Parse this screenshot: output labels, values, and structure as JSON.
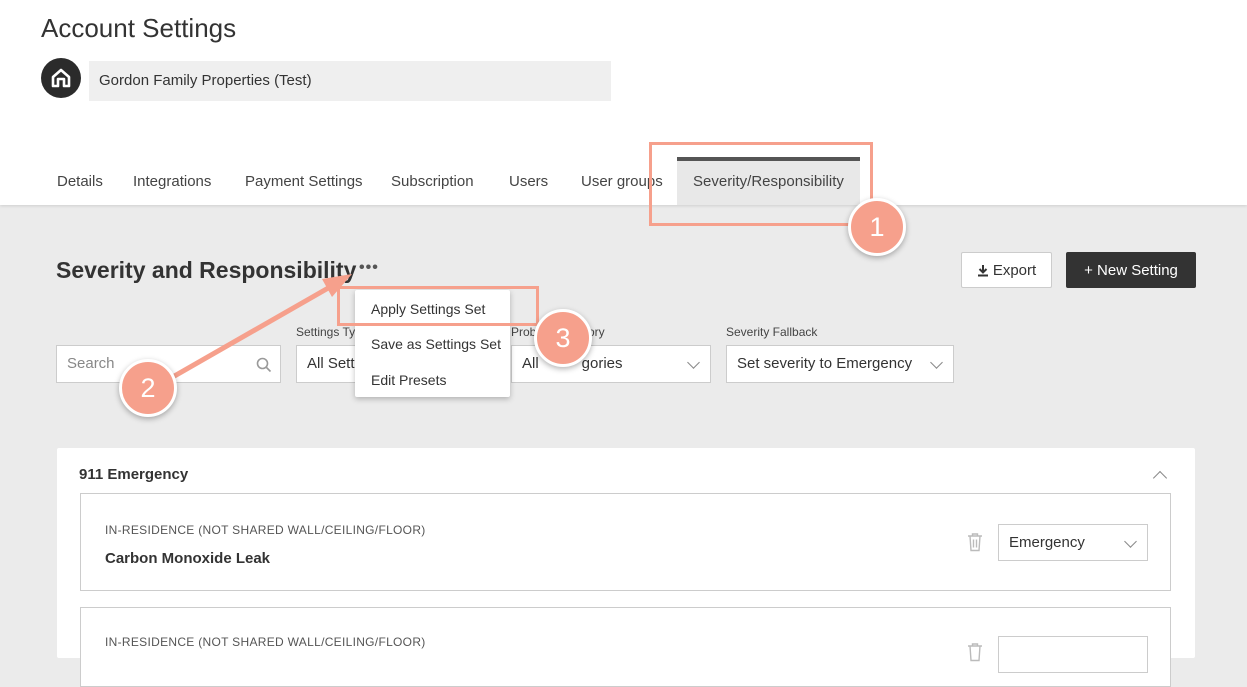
{
  "header": {
    "title": "Account Settings",
    "account_name": "Gordon Family Properties (Test)"
  },
  "tabs": [
    {
      "label": "Details"
    },
    {
      "label": "Integrations"
    },
    {
      "label": "Payment Settings"
    },
    {
      "label": "Subscription"
    },
    {
      "label": "Users"
    },
    {
      "label": "User groups"
    },
    {
      "label": "Severity/Responsibility",
      "active": true
    }
  ],
  "section": {
    "title": "Severity and Responsibility",
    "more": "•••",
    "export_label": "Export",
    "new_setting_label": "+ New Setting"
  },
  "filters": {
    "search_placeholder": "Search",
    "settings_type_label": "Settings Ty",
    "settings_type_value": "All Sett",
    "problem_category_label_a": "Prob",
    "problem_category_label_b": "ory",
    "problem_category_value_a": "All",
    "problem_category_value_b": "gories",
    "severity_fallback_label": "Severity Fallback",
    "severity_fallback_value": "Set severity to Emergency"
  },
  "menu": {
    "items": [
      "Apply Settings Set",
      "Save as Settings Set",
      "Edit Presets"
    ]
  },
  "group": {
    "title": "911 Emergency",
    "items": [
      {
        "category": "IN-RESIDENCE (NOT SHARED WALL/CEILING/FLOOR)",
        "name": "Carbon Monoxide Leak",
        "severity": "Emergency"
      },
      {
        "category": "IN-RESIDENCE (NOT SHARED WALL/CEILING/FLOOR)",
        "name": "",
        "severity": ""
      }
    ]
  },
  "annotations": {
    "badges": [
      "1",
      "2",
      "3"
    ],
    "color": "#f6a08c"
  },
  "colors": {
    "primary_button": "#333333",
    "highlight": "#f6a08c"
  }
}
